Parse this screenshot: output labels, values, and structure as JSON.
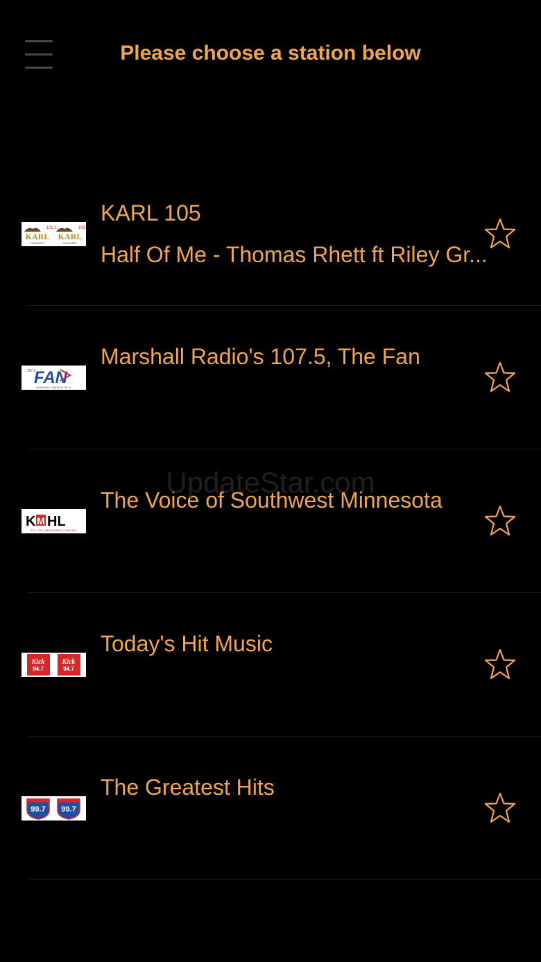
{
  "header": {
    "title": "Please choose a station below"
  },
  "accent_color": "#f0a64a",
  "stations": [
    {
      "title": "KARL 105",
      "subtitle": "Half Of Me - Thomas Rhett ft Riley Gr...",
      "logo_text": "KARL",
      "logo_colors": [
        "#b8862a",
        "#c0392b"
      ]
    },
    {
      "title": "Marshall Radio's 107.5, The Fan",
      "subtitle": "",
      "logo_text": "FAN",
      "logo_colors": [
        "#1f4fa3",
        "#d62828"
      ]
    },
    {
      "title": "The Voice of Southwest Minnesota",
      "subtitle": "",
      "logo_text": "KMHL",
      "logo_colors": [
        "#000000",
        "#d62828"
      ]
    },
    {
      "title": "Today's Hit Music",
      "subtitle": "",
      "logo_text": "Kick 94.7",
      "logo_colors": [
        "#d62828",
        "#ffffff"
      ]
    },
    {
      "title": "The Greatest Hits",
      "subtitle": "",
      "logo_text": "99.7",
      "logo_colors": [
        "#1f4fa3",
        "#d62828"
      ]
    }
  ],
  "icons": {
    "menu": "hamburger-menu-icon",
    "favorite": "star-outline-icon"
  },
  "watermark": "UpdateStar.com"
}
